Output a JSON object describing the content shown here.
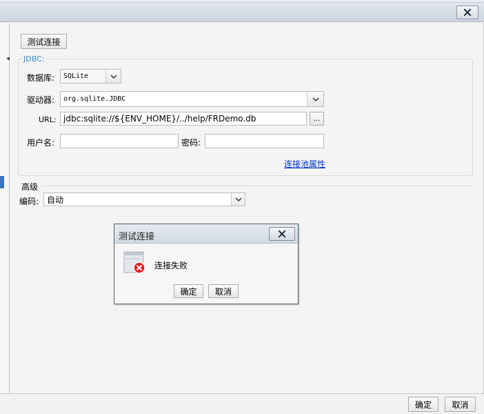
{
  "window": {
    "close_icon": "close-icon"
  },
  "toolbar": {
    "test_connection_label": "测试连接"
  },
  "jdbc": {
    "group_title": "JDBC:",
    "database_label": "数据库:",
    "database_value": "SQLite",
    "driver_label": "驱动器:",
    "driver_value": "org.sqlite.JDBC",
    "url_label": "URL:",
    "url_value": "jdbc:sqlite://${ENV_HOME}/../help/FRDemo.db",
    "browse_label": "...",
    "username_label": "用户名:",
    "username_value": "",
    "password_label": "密码:",
    "password_value": "",
    "pool_link": "连接池属性"
  },
  "advanced": {
    "section_label": "高级",
    "encoding_label": "编码:",
    "encoding_value": "自动"
  },
  "dialog": {
    "title": "测试连接",
    "message": "连接失败",
    "ok_label": "确定",
    "cancel_label": "取消",
    "icon": "connection-error-icon"
  },
  "footer": {
    "ok_label": "确定",
    "cancel_label": "取消"
  },
  "colors": {
    "accent_link": "#0033cc",
    "group_title": "#2d8fd8",
    "error_red": "#e02020"
  }
}
